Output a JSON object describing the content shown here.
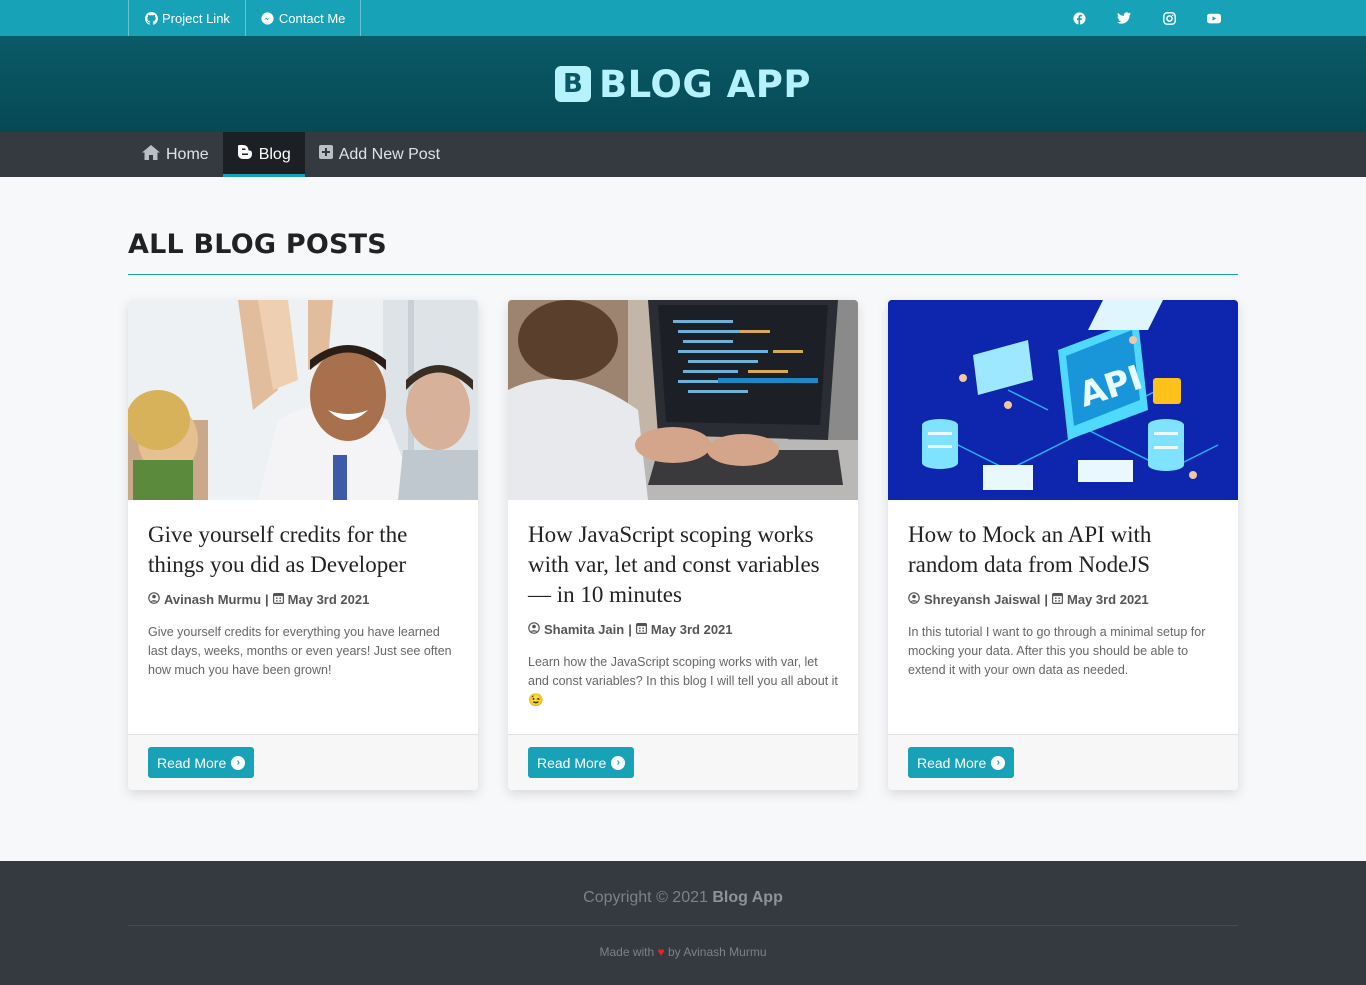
{
  "topbar": {
    "links": [
      {
        "label": "Project Link",
        "icon": "github-icon"
      },
      {
        "label": "Contact Me",
        "icon": "messenger-icon"
      }
    ],
    "social": [
      "facebook-icon",
      "twitter-icon",
      "instagram-icon",
      "youtube-icon"
    ]
  },
  "header": {
    "logo_letter": "B",
    "title": "BLOG APP"
  },
  "nav": {
    "items": [
      {
        "label": "Home",
        "icon": "home-icon",
        "active": false
      },
      {
        "label": "Blog",
        "icon": "blogger-icon",
        "active": true
      },
      {
        "label": "Add New Post",
        "icon": "plus-square-icon",
        "active": false
      }
    ]
  },
  "main": {
    "title": "ALL BLOG POSTS",
    "posts": [
      {
        "title": "Give yourself credits for the things you did as Developer",
        "author": "Avinash Murmu",
        "date": "May 3rd 2021",
        "excerpt": "Give yourself credits for everything you have learned last days, weeks, months or even years! Just see often how much you have been grown!",
        "button": "Read More",
        "image": "team-high-five-photo"
      },
      {
        "title": "How JavaScript scoping works with var, let and const variables — in 10 minutes",
        "author": "Shamita Jain",
        "date": "May 3rd 2021",
        "excerpt": "Learn how the JavaScript scoping works with var, let and const variables? In this blog I will tell you all about it 😉",
        "button": "Read More",
        "image": "laptop-coding-photo"
      },
      {
        "title": "How to Mock an API with random data from NodeJS",
        "author": "Shreyansh Jaiswal",
        "date": "May 3rd 2021",
        "excerpt": "In this tutorial I want to go through a minimal setup for mocking your data. After this you should be able to extend it with your own data as needed.",
        "button": "Read More",
        "image": "api-isometric-illustration"
      }
    ]
  },
  "footer": {
    "copyright_prefix": "Copyright © 2021",
    "copyright_brand": "Blog App",
    "made_prefix": "Made with",
    "made_heart": "♥",
    "made_suffix": "by Avinash Murmu"
  },
  "colors": {
    "accent": "#17a2b8",
    "header_bg": "#075260",
    "nav_bg": "#343a40",
    "brand_text": "#b5f2fb"
  }
}
